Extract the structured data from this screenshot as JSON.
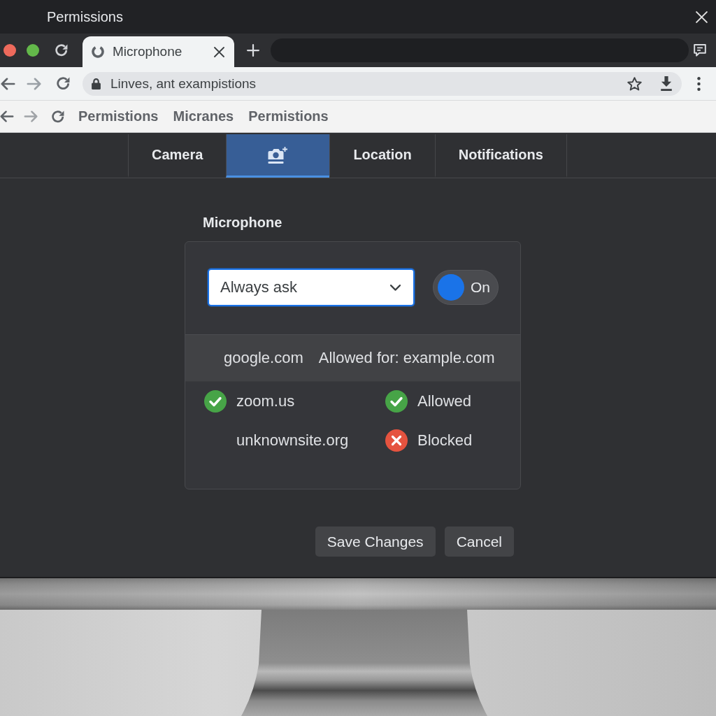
{
  "window": {
    "title": "Permissions"
  },
  "browser": {
    "tabs": [
      {
        "label": "Microphone",
        "selected": true
      }
    ],
    "address_bar": {
      "value": "Linves, ant exampistions"
    },
    "nav_links": [
      "Permistions",
      "Micranes",
      "Permistions"
    ]
  },
  "permission_tabs": [
    {
      "kind": "text",
      "label": "Camera",
      "selected": false
    },
    {
      "kind": "icon",
      "selected": true
    },
    {
      "kind": "text",
      "label": "Location",
      "selected": false
    },
    {
      "kind": "text",
      "label": "Notifications",
      "selected": false
    }
  ],
  "panel": {
    "title": "Microphone",
    "setting": {
      "value": "Always ask",
      "focused": true
    },
    "toggle": {
      "label": "On",
      "on": true
    },
    "sites": [
      {
        "kind": "summary",
        "site": "google.com",
        "status": "Allowed for: example.com"
      },
      {
        "kind": "allowed",
        "site": "zoom.us",
        "checked": true,
        "status": "Allowed"
      },
      {
        "kind": "blocked",
        "site": "unknownsite.org",
        "checked": false,
        "status": "Blocked"
      }
    ]
  },
  "buttons": [
    {
      "label": "Save Changes"
    },
    {
      "label": "Cancel"
    }
  ]
}
